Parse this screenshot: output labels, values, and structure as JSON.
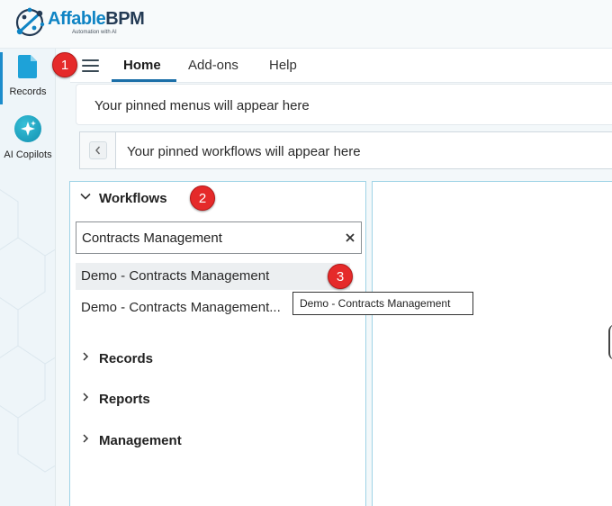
{
  "brand": {
    "name_part1": "Affable",
    "name_part2": "BPM",
    "tagline": "Automation with AI",
    "colors": {
      "primary": "#0f84c4",
      "dark": "#243b55",
      "accent": "#1b6fa8"
    }
  },
  "rail": {
    "items": [
      {
        "label": "Records",
        "icon": "document-icon",
        "active": true
      },
      {
        "label": "AI Copilots",
        "icon": "sparkle-icon",
        "active": false
      }
    ]
  },
  "nav": {
    "menu_icon": "hamburger-menu-icon",
    "tabs": [
      {
        "label": "Home",
        "active": true
      },
      {
        "label": "Add-ons",
        "active": false
      },
      {
        "label": "Help",
        "active": false
      }
    ]
  },
  "pinned": {
    "menus_text": "Your pinned menus will appear here",
    "workflows_text": "Your pinned workflows will appear here",
    "back_icon": "chevron-left-icon"
  },
  "sidebar": {
    "sections": [
      {
        "label": "Workflows",
        "expanded": true,
        "icon": "chevron-down-icon"
      },
      {
        "label": "Records",
        "expanded": false,
        "icon": "chevron-right-icon"
      },
      {
        "label": "Reports",
        "expanded": false,
        "icon": "chevron-right-icon"
      },
      {
        "label": "Management",
        "expanded": false,
        "icon": "chevron-right-icon"
      }
    ],
    "search": {
      "value": "Contracts Management",
      "clear_icon": "close-icon"
    },
    "results": [
      {
        "label": "Demo - Contracts Management",
        "hovered": true
      },
      {
        "label": "Demo - Contracts Management..."
      }
    ]
  },
  "tooltip": {
    "text": "Demo - Contracts Management"
  },
  "markers": [
    "1",
    "2",
    "3"
  ]
}
